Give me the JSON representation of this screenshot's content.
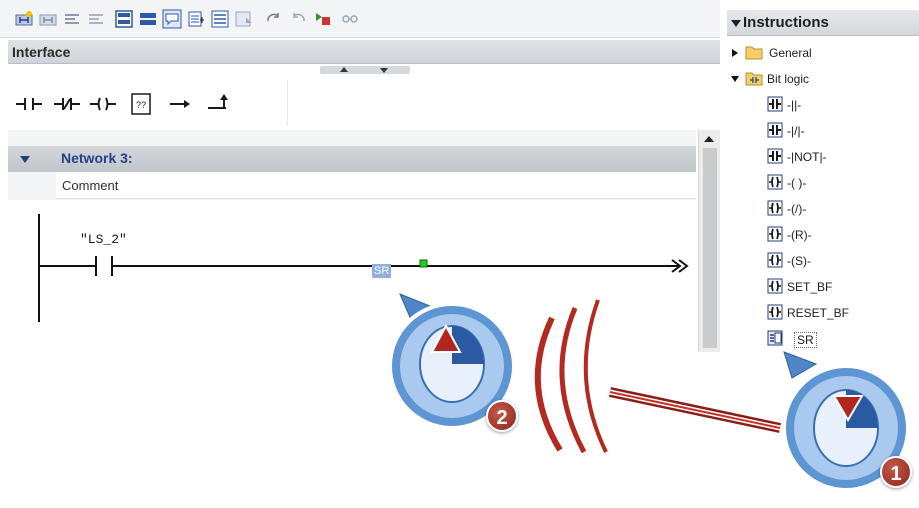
{
  "editor": {
    "interface_label": "Interface",
    "network": {
      "title": "Network 3:",
      "comment": "Comment",
      "contact_tag": "\"LS_2\""
    },
    "dragged_instruction": "SR"
  },
  "instructions_panel": {
    "title": "Instructions",
    "folders": [
      {
        "label": "General",
        "expanded": false
      },
      {
        "label": "Bit logic",
        "expanded": true
      }
    ],
    "items": [
      {
        "label": "-||-",
        "icon": "contact-icon"
      },
      {
        "label": "-|/|-",
        "icon": "contact-icon"
      },
      {
        "label": "-|NOT|-",
        "icon": "contact-icon"
      },
      {
        "label": "-( )-",
        "icon": "coil-icon"
      },
      {
        "label": "-(/)-",
        "icon": "coil-icon"
      },
      {
        "label": "-(R)-",
        "icon": "coil-icon"
      },
      {
        "label": "-(S)-",
        "icon": "coil-icon"
      },
      {
        "label": "SET_BF",
        "icon": "coil-icon"
      },
      {
        "label": "RESET_BF",
        "icon": "coil-icon"
      },
      {
        "label": "SR",
        "icon": "box-icon"
      }
    ]
  },
  "steps": {
    "step1": "1",
    "step2": "2"
  },
  "colors": {
    "accent_blue": "#27408b",
    "badge_red": "#9a2a1e",
    "mouse_blue": "#4f86c8",
    "green_marker": "#22cc22"
  }
}
